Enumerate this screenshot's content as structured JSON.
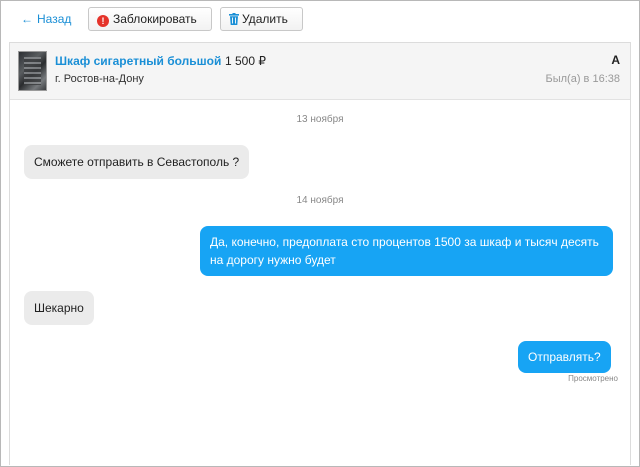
{
  "toolbar": {
    "back_label": "Назад",
    "block_label": "Заблокировать",
    "delete_label": "Удалить"
  },
  "header": {
    "item_title": "Шкаф сигаретный большой",
    "item_price": "1 500 ₽",
    "city": "г. Ростов-на-Дону",
    "user_initial": "А",
    "last_seen": "Был(а) в 16:38"
  },
  "messages": [
    {
      "date": "13 ноября"
    },
    {
      "direction": "in",
      "text": "Сможете отправить в Севастополь ?"
    },
    {
      "date": "14 ноября"
    },
    {
      "direction": "out",
      "text": "Да, конечно, предоплата сто процентов 1500 за шкаф и тысяч десять на дорогу нужно будет"
    },
    {
      "direction": "in",
      "text": "Шекарно"
    },
    {
      "direction": "out",
      "text": "Отправлять?"
    }
  ],
  "read_status": "Просмотрено",
  "colors": {
    "link": "#1a8fd6",
    "outgoing_bubble": "#17a4f4",
    "incoming_bubble": "#ebebeb",
    "block_icon": "#e5332a",
    "trash_icon": "#1a8fd6"
  },
  "icons": {
    "back": "arrow-left-icon",
    "block": "exclamation-circle-icon",
    "delete": "trash-icon"
  }
}
